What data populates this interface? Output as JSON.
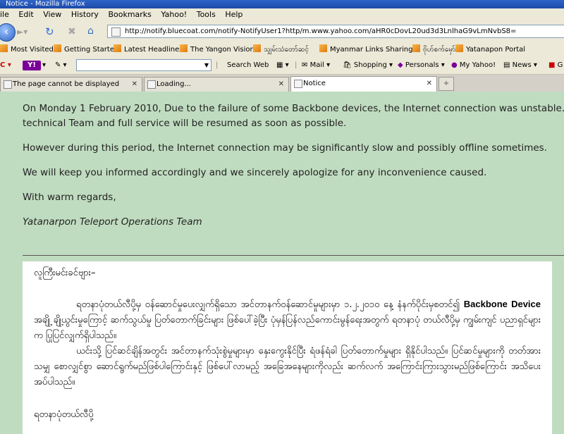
{
  "window": {
    "title": "Notice - Mozilla Firefox"
  },
  "menu": [
    "ile",
    "Edit",
    "View",
    "History",
    "Bookmarks",
    "Yahoo!",
    "Tools",
    "Help"
  ],
  "url": "http://notify.bluecoat.com/notify-NotifyUser1?http/m.www.yahoo.com/aHR0cDovL20ud3d3LnlhaG9vLmNvbS8=",
  "bookmarks": [
    "Most Visited",
    "Getting Started",
    "Latest Headlines",
    "The Yangon Vision",
    "သျှမ်းသံတော်ဆင့်",
    "Myanmar Links Sharing",
    "ဗိုဟ်စက်မှော်",
    "Yatanapon Portal"
  ],
  "yahoo_toolbar": {
    "logo": "Y!",
    "search_value": "",
    "search_web": "Search Web",
    "mail": "Mail",
    "shopping": "Shopping",
    "personals": "Personals",
    "my_yahoo": "My Yahoo!",
    "news": "News",
    "g": "G"
  },
  "tabs": [
    {
      "label": "The page cannot be displayed"
    },
    {
      "label": "Loading..."
    },
    {
      "label": "Notice"
    }
  ],
  "notice": {
    "para1_line1": "On Monday 1 February 2010, Due to the failure of some Backbone devices, the Internet connection was unstable. It is currently being",
    "para1_line2": "technical Team and full service will be resumed as soon as possible.",
    "para2": "However during this period, the Internet connection may be significantly slow and possibly offline sometimes.",
    "para3": "We will keep you informed accordingly and we sincerely apologize for any inconvenience caused.",
    "regards": "With warm regards,",
    "team": "Yatanarpon Teleport Operations Team"
  },
  "myanmar": {
    "greeting": "လူကြီးမင်းခင်ဗျား–",
    "para1_before": "ရတနာပုံတယ်လီပို့မှ ဝန်ဆောင်မှုပေးလျှက်ရှိသော အင်တာနက်ဝန်ဆောင်မှုများမှာ ၁.၂.၂၀၁၀ နေ့ နံနက်ပိုင်းမှစတင်၍",
    "para1_bold": "Backbone Device",
    "para1_after": "အချို့ ချို့ယွင်းမှုကြောင့် ဆက်သွယ်မှု ပြတ်တောက်ခြင်းများ ဖြစ်ပေါ်ခဲ့ပြီး ပုံမှန်ပြန်လည်ကောင်းမွန်ရေးအတွက် ရတနာပုံ တယ်လီပို့မှ ကျွမ်းကျင် ပညာရှင်များက ပြုပြင်လျှက်ရှိပါသည်။",
    "para2": "ယင်းသို့ ပြင်ဆင်ချိန်အတွင်း အင်တာနက်သုံးစွဲမှုများမှာ နှေးကွေးနိုင်ပြီး ရံဖန်ရံခါ ပြတ်တောက်မှုများ ရှိနိုင်ပါသည်။ ပြင်ဆင်မှုများကို တတ်အားသမျှ စောလျှင်စွာ ဆောင်ရွက်မည်ဖြစ်ပါကြောင်းနှင့် ဖြစ်ပေါ်လာမည့် အခြေအနေများကိုလည်း ဆက်လက် အကြောင်းကြားသွားမည်ဖြစ်ကြောင်း အသိပေးအပ်ပါသည်။",
    "signoff": "ရတနာပုံတယ်လီပို့"
  }
}
